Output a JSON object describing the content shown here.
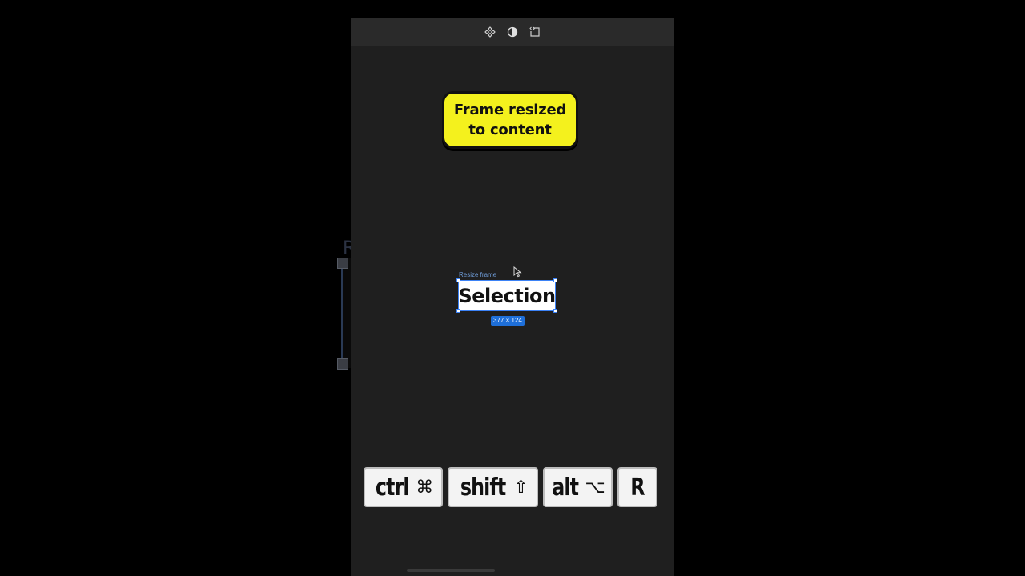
{
  "toolbar": {
    "icons": [
      "component-icon",
      "contrast-icon",
      "code-frame-icon"
    ]
  },
  "callout": {
    "line1": "Frame resized",
    "line2": "to content",
    "color": "#f4f11d"
  },
  "canvas": {
    "frame_label": "Resize frame",
    "frame_text": "Selection",
    "size_badge": "377 × 124",
    "selection_color": "#3b82f6"
  },
  "shortcut": {
    "keys": [
      {
        "label": "ctrl",
        "symbol": "⌘"
      },
      {
        "label": "shift",
        "symbol": "⇧"
      },
      {
        "label": "alt",
        "symbol": "⌥"
      },
      {
        "label": "R",
        "symbol": ""
      }
    ]
  }
}
